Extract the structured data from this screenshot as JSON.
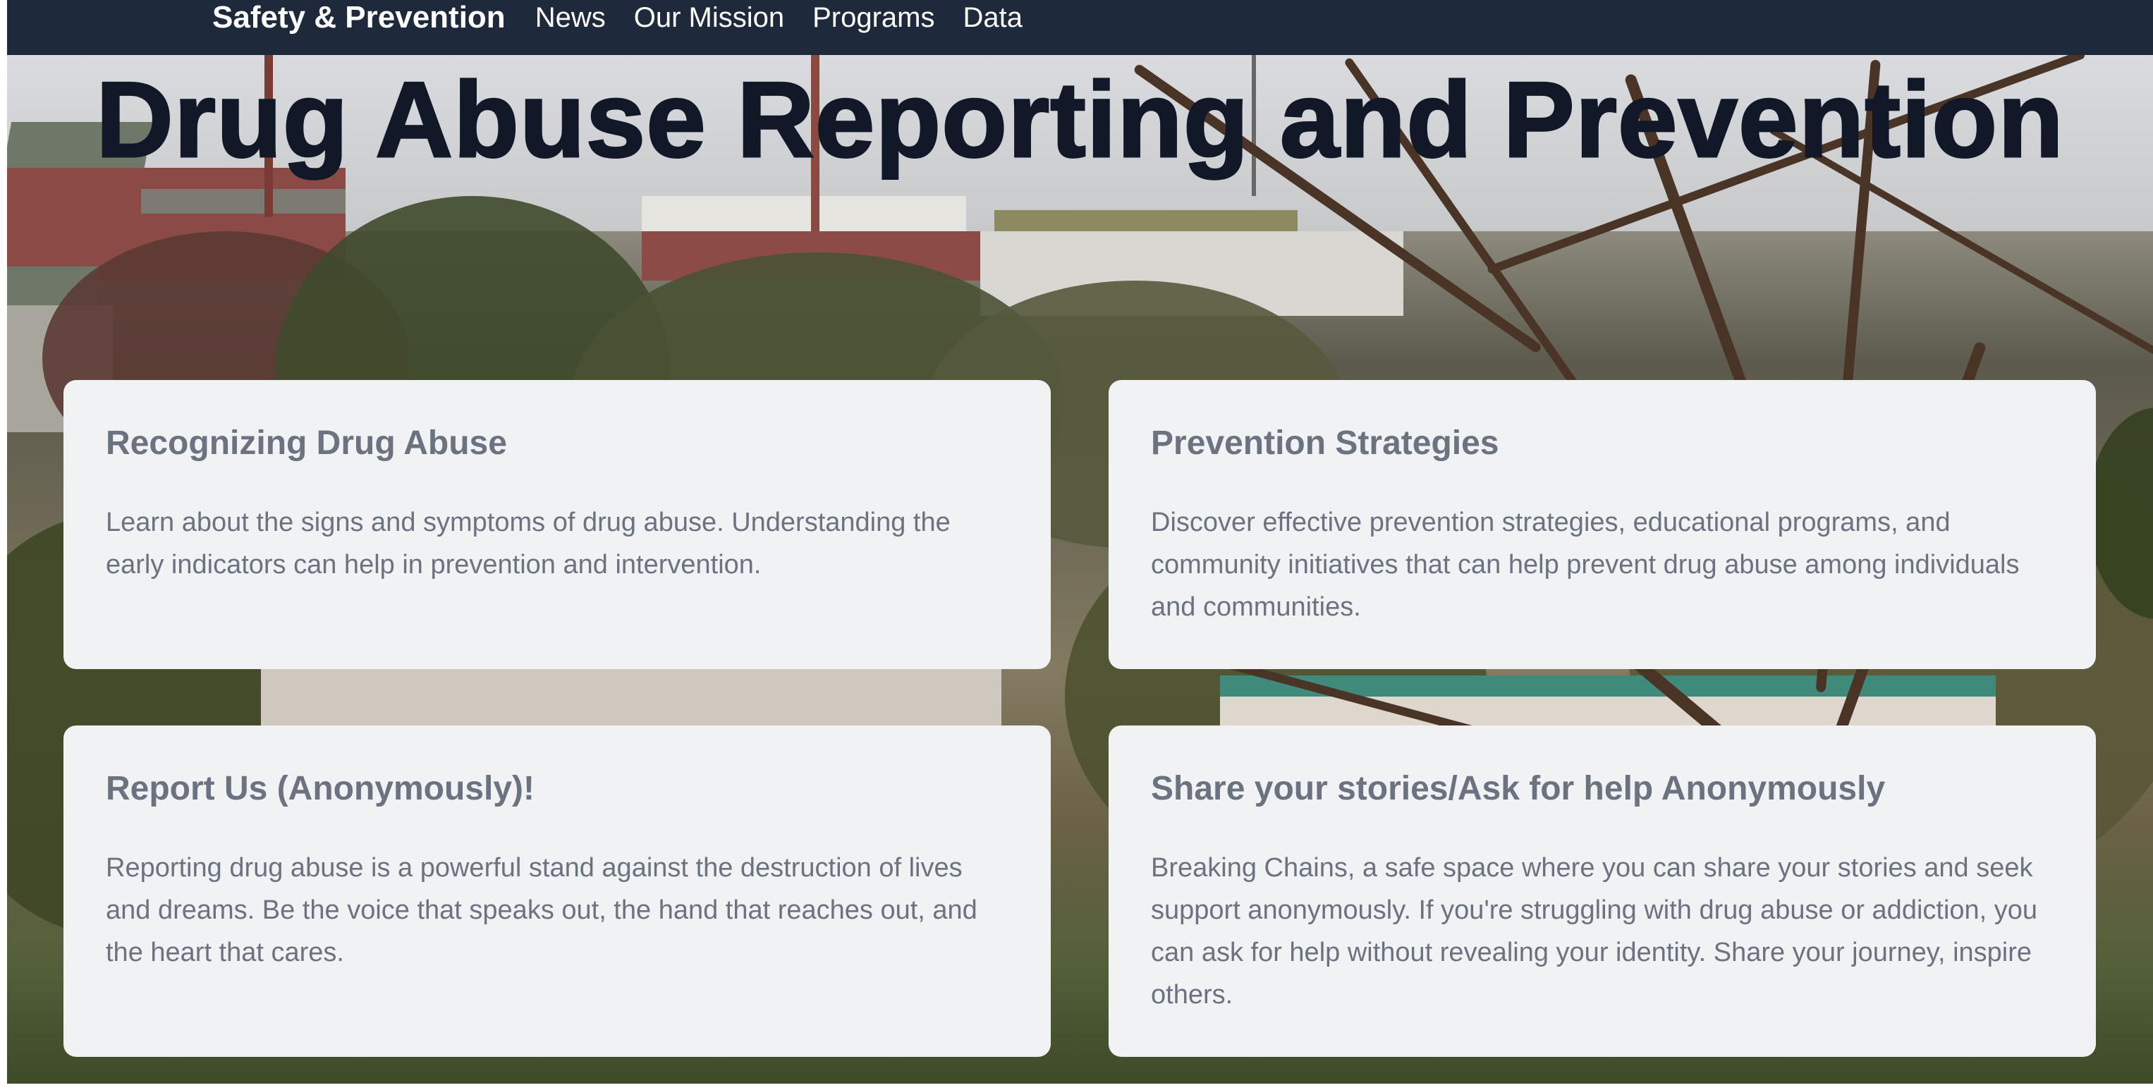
{
  "navbar": {
    "brand": "Safety & Prevention",
    "links": [
      "News",
      "Our Mission",
      "Programs",
      "Data"
    ]
  },
  "hero": {
    "title": "Drug Abuse Reporting and Prevention"
  },
  "cards": [
    {
      "heading": "Recognizing Drug Abuse",
      "text": "Learn about the signs and symptoms of drug abuse. Understanding the early indicators can help in prevention and intervention."
    },
    {
      "heading": "Prevention Strategies",
      "text": "Discover effective prevention strategies, educational programs, and community initiatives that can help prevent drug abuse among individuals and communities."
    },
    {
      "heading": "Report Us (Anonymously)!",
      "text": "Reporting drug abuse is a powerful stand against the destruction of lives and dreams. Be the voice that speaks out, the hand that reaches out, and the heart that cares."
    },
    {
      "heading": "Share your stories/Ask for help Anonymously",
      "text": "Breaking Chains, a safe space where you can share your stories and seek support anonymously. If you're struggling with drug abuse or addiction, you can ask for help without revealing your identity. Share your journey, inspire others."
    }
  ],
  "colors": {
    "navbar_bg": "#1e293b",
    "card_bg": "#f1f2f4",
    "card_text": "#6b7280",
    "title_text": "#111827"
  }
}
